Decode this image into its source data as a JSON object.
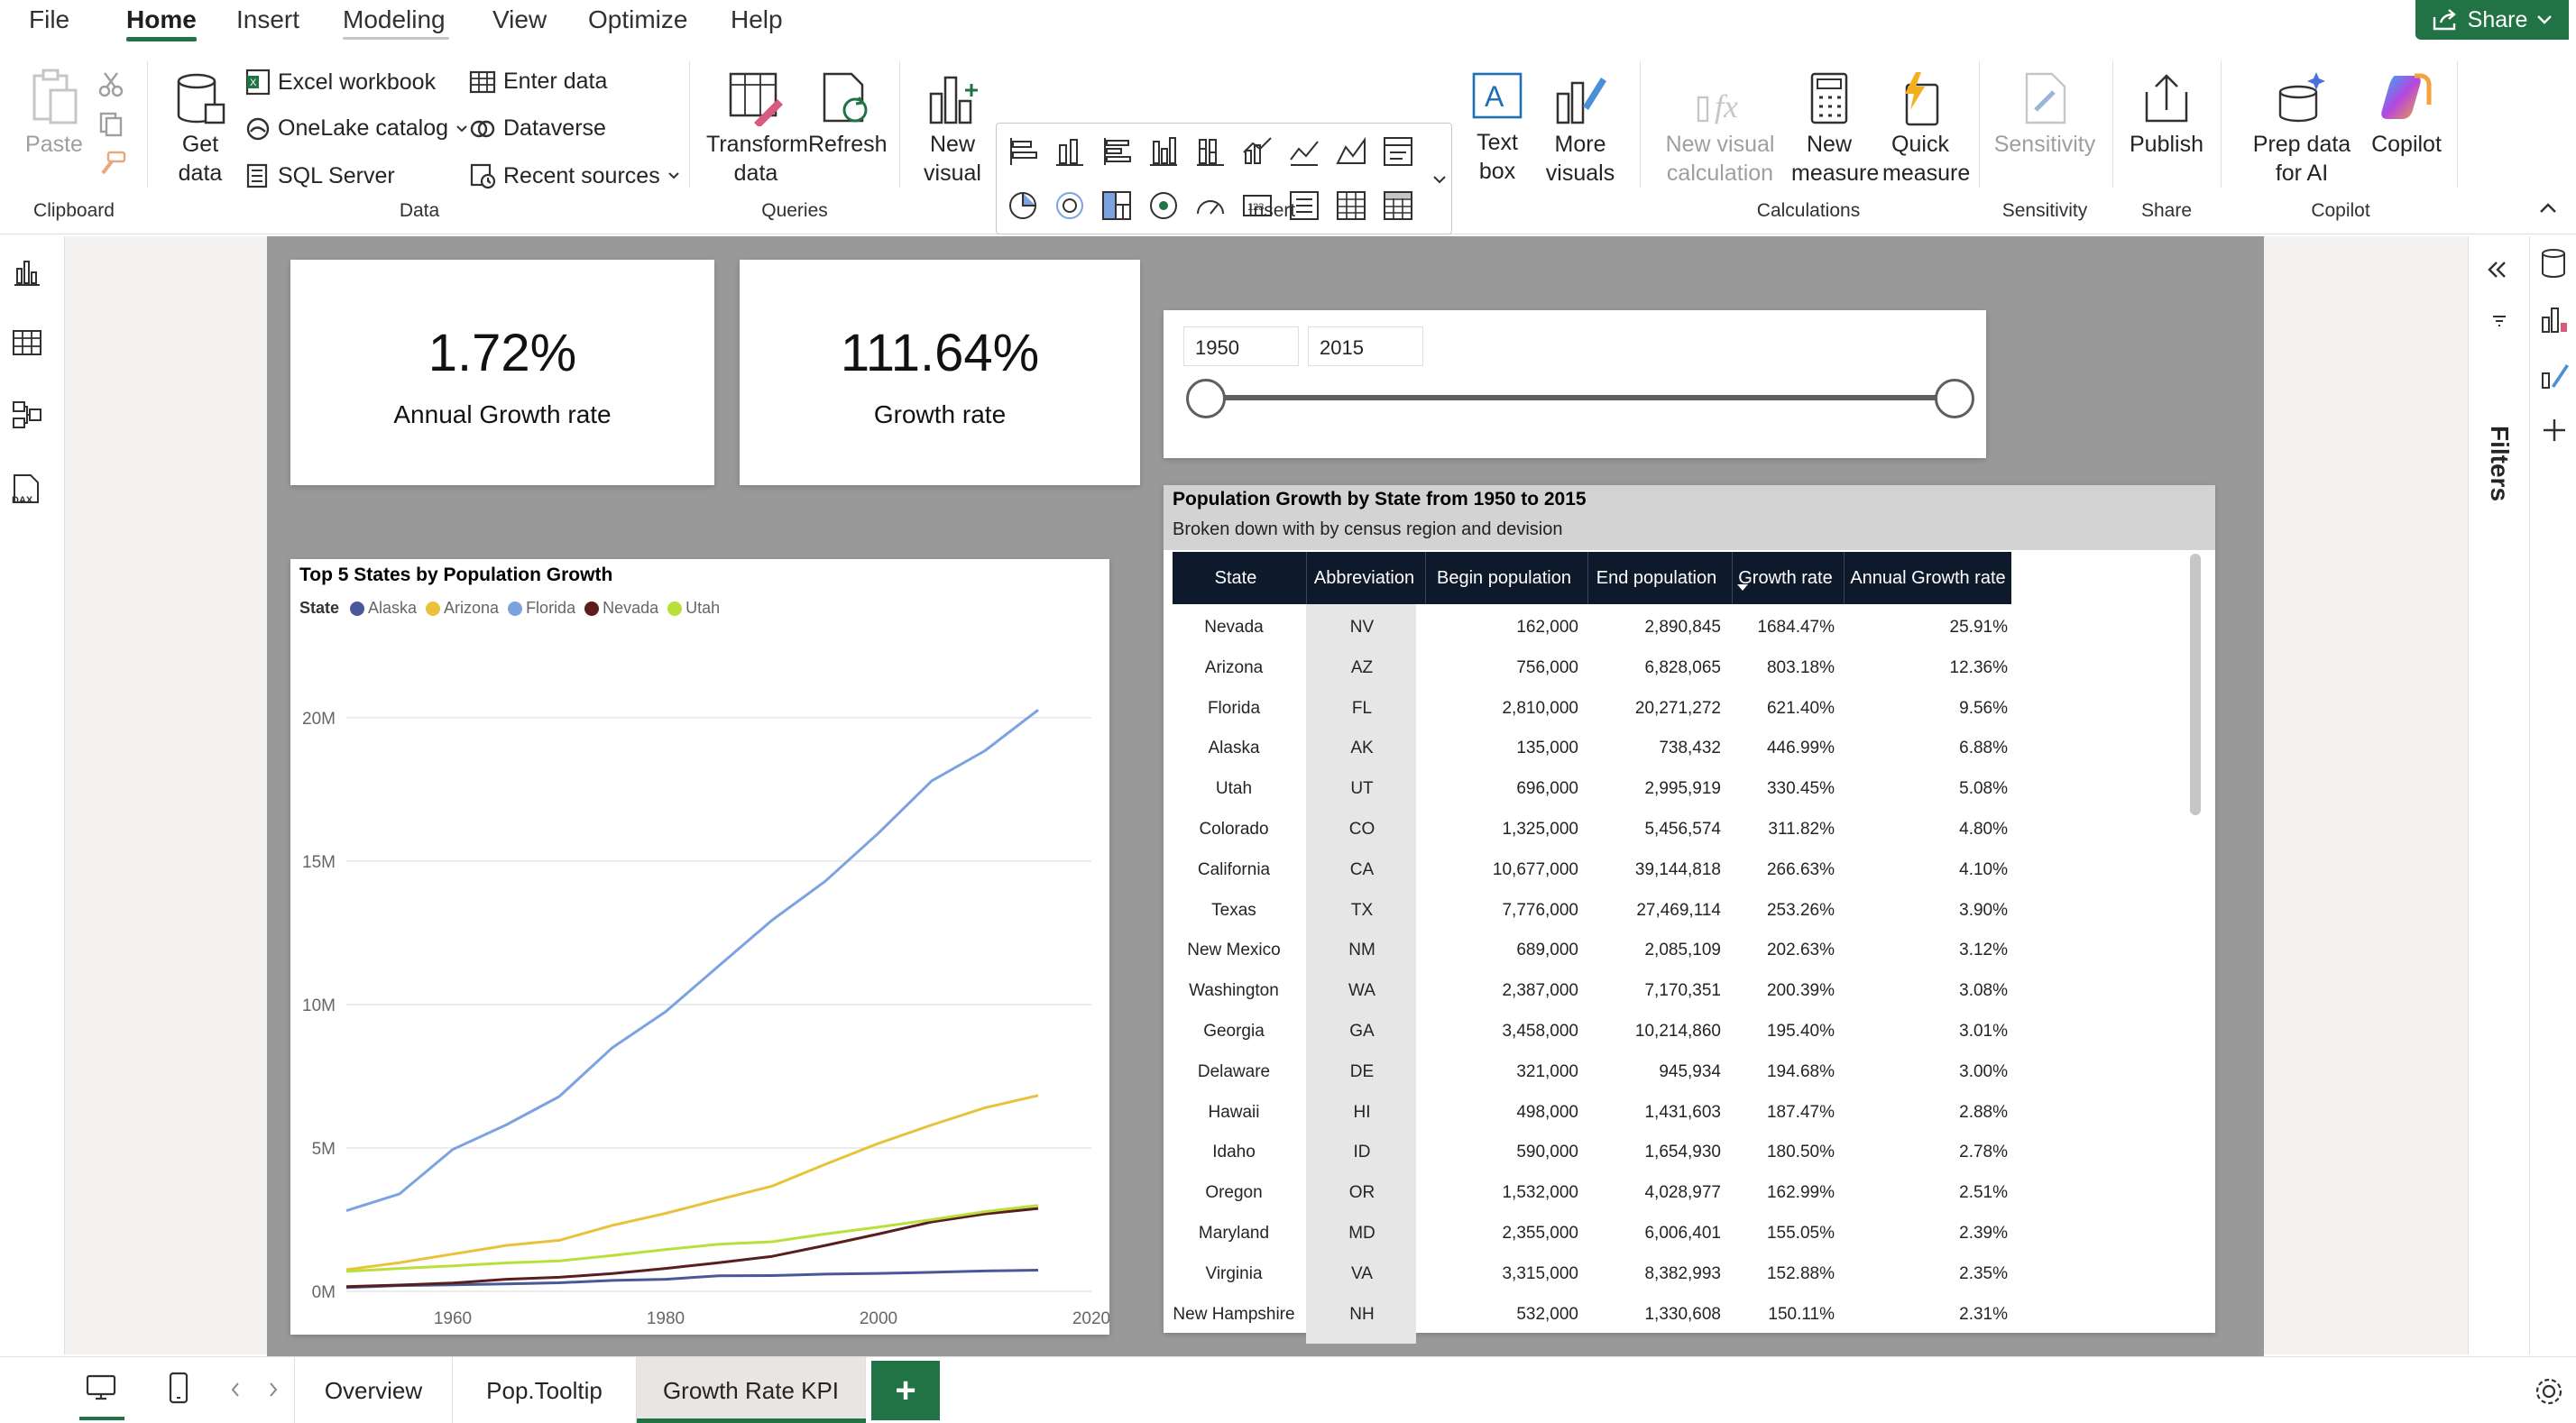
{
  "menu": {
    "items": [
      "File",
      "Home",
      "Insert",
      "Modeling",
      "View",
      "Optimize",
      "Help"
    ],
    "active": "Home",
    "share_label": "Share"
  },
  "ribbon": {
    "clipboard": {
      "paste": "Paste",
      "group": "Clipboard"
    },
    "data": {
      "get_data": "Get data",
      "excel": "Excel workbook",
      "onelake": "OneLake catalog",
      "sql": "SQL Server",
      "enter": "Enter data",
      "dataverse": "Dataverse",
      "recent": "Recent sources",
      "group": "Data"
    },
    "queries": {
      "transform": "Transform data",
      "refresh": "Refresh",
      "group": "Queries"
    },
    "insert": {
      "new_visual": "New visual",
      "text_box": "Text box",
      "more_visuals": "More visuals",
      "group": "Insert"
    },
    "calculations": {
      "new_visual_calc": "New visual calculation",
      "new_measure": "New measure",
      "quick_measure": "Quick measure",
      "group": "Calculations"
    },
    "sensitivity": {
      "label": "Sensitivity",
      "group": "Sensitivity"
    },
    "share": {
      "publish": "Publish",
      "group": "Share"
    },
    "copilot": {
      "prep": "Prep data for AI",
      "copilot": "Copilot",
      "group": "Copilot"
    }
  },
  "kpi": {
    "annual_value": "1.72%",
    "annual_label": "Annual Growth rate",
    "growth_value": "111.64%",
    "growth_label": "Growth rate"
  },
  "slicer": {
    "from": "1950",
    "to": "2015",
    "range_fraction": [
      0,
      1
    ]
  },
  "chart_data": {
    "type": "line",
    "title": "Top 5 States by Population Growth",
    "legend_title": "State",
    "legend_position": "top-left",
    "ylim": [
      0,
      20500000
    ],
    "xlim": [
      1950,
      2020
    ],
    "y_ticks": [
      "0M",
      "5M",
      "10M",
      "15M",
      "20M"
    ],
    "y_tick_values": [
      0,
      5000000,
      10000000,
      15000000,
      20000000
    ],
    "x_ticks": [
      "1960",
      "1980",
      "2000",
      "2020"
    ],
    "x_tick_values": [
      1960,
      1980,
      2000,
      2020
    ],
    "grid": true,
    "x": [
      1950,
      1955,
      1960,
      1965,
      1970,
      1975,
      1980,
      1985,
      1990,
      1995,
      2000,
      2005,
      2010,
      2015
    ],
    "series": [
      {
        "name": "Alaska",
        "color": "#4a5899",
        "values": [
          135000,
          200000,
          230000,
          260000,
          300000,
          380000,
          420000,
          540000,
          550000,
          600000,
          627000,
          663000,
          710000,
          738432
        ]
      },
      {
        "name": "Arizona",
        "color": "#e8c33a",
        "values": [
          756000,
          1000000,
          1300000,
          1600000,
          1780000,
          2300000,
          2720000,
          3200000,
          3670000,
          4430000,
          5160000,
          5800000,
          6400000,
          6828065
        ]
      },
      {
        "name": "Florida",
        "color": "#7ba3e0",
        "values": [
          2810000,
          3400000,
          4950000,
          5800000,
          6790000,
          8500000,
          9750000,
          11350000,
          12940000,
          14300000,
          15980000,
          17800000,
          18850000,
          20271272
        ]
      },
      {
        "name": "Nevada",
        "color": "#5a1e1e",
        "values": [
          162000,
          220000,
          290000,
          420000,
          490000,
          620000,
          800000,
          1000000,
          1220000,
          1600000,
          2000000,
          2420000,
          2700000,
          2890845
        ]
      },
      {
        "name": "Utah",
        "color": "#b9e038",
        "values": [
          696000,
          800000,
          890000,
          990000,
          1060000,
          1250000,
          1460000,
          1640000,
          1730000,
          2000000,
          2240000,
          2500000,
          2780000,
          2995919
        ]
      }
    ]
  },
  "table": {
    "title": "Population Growth by State from 1950 to 2015",
    "subtitle": "Broken down with by census region and devision",
    "columns": [
      "State",
      "Abbreviation",
      "Begin population",
      "End population",
      "Growth rate",
      "Annual Growth rate"
    ],
    "rows": [
      [
        "Nevada",
        "NV",
        "162,000",
        "2,890,845",
        "1684.47%",
        "25.91%"
      ],
      [
        "Arizona",
        "AZ",
        "756,000",
        "6,828,065",
        "803.18%",
        "12.36%"
      ],
      [
        "Florida",
        "FL",
        "2,810,000",
        "20,271,272",
        "621.40%",
        "9.56%"
      ],
      [
        "Alaska",
        "AK",
        "135,000",
        "738,432",
        "446.99%",
        "6.88%"
      ],
      [
        "Utah",
        "UT",
        "696,000",
        "2,995,919",
        "330.45%",
        "5.08%"
      ],
      [
        "Colorado",
        "CO",
        "1,325,000",
        "5,456,574",
        "311.82%",
        "4.80%"
      ],
      [
        "California",
        "CA",
        "10,677,000",
        "39,144,818",
        "266.63%",
        "4.10%"
      ],
      [
        "Texas",
        "TX",
        "7,776,000",
        "27,469,114",
        "253.26%",
        "3.90%"
      ],
      [
        "New Mexico",
        "NM",
        "689,000",
        "2,085,109",
        "202.63%",
        "3.12%"
      ],
      [
        "Washington",
        "WA",
        "2,387,000",
        "7,170,351",
        "200.39%",
        "3.08%"
      ],
      [
        "Georgia",
        "GA",
        "3,458,000",
        "10,214,860",
        "195.40%",
        "3.01%"
      ],
      [
        "Delaware",
        "DE",
        "321,000",
        "945,934",
        "194.68%",
        "3.00%"
      ],
      [
        "Hawaii",
        "HI",
        "498,000",
        "1,431,603",
        "187.47%",
        "2.88%"
      ],
      [
        "Idaho",
        "ID",
        "590,000",
        "1,654,930",
        "180.50%",
        "2.78%"
      ],
      [
        "Oregon",
        "OR",
        "1,532,000",
        "4,028,977",
        "162.99%",
        "2.51%"
      ],
      [
        "Maryland",
        "MD",
        "2,355,000",
        "6,006,401",
        "155.05%",
        "2.39%"
      ],
      [
        "Virginia",
        "VA",
        "3,315,000",
        "8,382,993",
        "152.88%",
        "2.35%"
      ],
      [
        "New Hampshire",
        "NH",
        "532,000",
        "1,330,608",
        "150.11%",
        "2.31%"
      ]
    ]
  },
  "filters_label": "Filters",
  "pages": {
    "tabs": [
      "Overview",
      "Pop.Tooltip",
      "Growth Rate KPI"
    ],
    "active": "Growth Rate KPI",
    "add_label": "+"
  },
  "colors": {
    "accent": "#217346",
    "table_header": "#0e1a2b",
    "canvas": "#999999"
  }
}
